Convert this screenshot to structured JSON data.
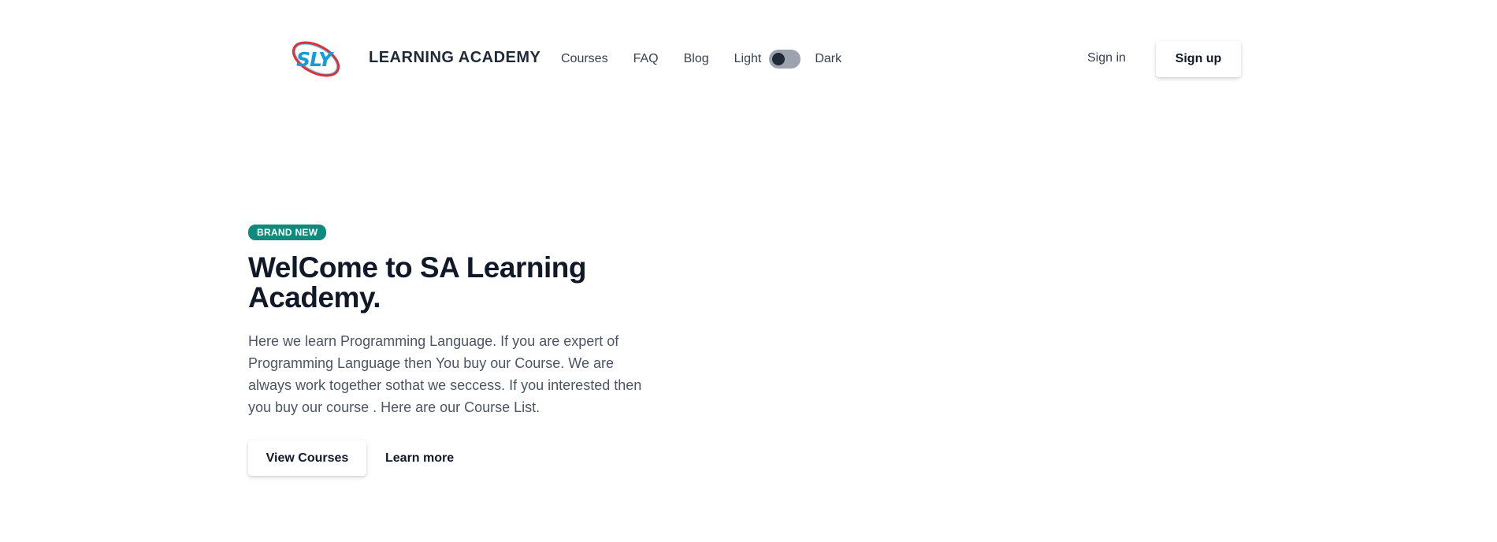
{
  "brand": {
    "logo_text": "SLY",
    "name": "LEARNING ACADEMY"
  },
  "nav": {
    "links": [
      {
        "label": "Courses"
      },
      {
        "label": "FAQ"
      },
      {
        "label": "Blog"
      }
    ],
    "theme": {
      "light_label": "Light",
      "dark_label": "Dark",
      "state": "light"
    }
  },
  "auth": {
    "signin_label": "Sign in",
    "signup_label": "Sign up"
  },
  "hero": {
    "badge": "BRAND NEW",
    "title": "WelCome to SA Learning Academy.",
    "description": "Here we learn Programming Language. If you are expert of Programming Language then You buy our Course. We are always work together sothat we seccess. If you interested then you buy our course . Here are our Course List.",
    "primary_button": "View Courses",
    "secondary_link": "Learn more"
  },
  "colors": {
    "badge_bg": "#0f8b7e",
    "logo_blue": "#1a9ad6",
    "logo_red": "#e0303a",
    "toggle_track": "#9ca3af",
    "toggle_knob": "#1f2937"
  },
  "icons": {
    "logo": "sly-orbit-logo"
  }
}
